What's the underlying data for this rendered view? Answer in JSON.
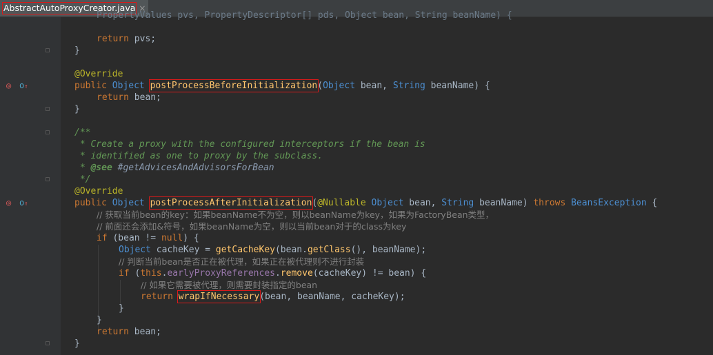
{
  "tab": {
    "filename": "AbstractAutoProxyCreator.java",
    "close": "×"
  },
  "code": {
    "l1": {
      "text": "PropertyValues pvs, PropertyDescriptor[] pds, Object bean, String beanName) {"
    },
    "l2": {
      "kw": "return",
      "rest": " pvs;"
    },
    "l3": "}",
    "l4": "@Override",
    "l5": {
      "kw": "public",
      "type": "Object",
      "method": "postProcessBeforeInitialization",
      "rest1": "(",
      "t2": "Object",
      "rest2": " bean, ",
      "t3": "String",
      "rest3": " beanName) {"
    },
    "l6": {
      "kw": "return",
      "rest": " bean;"
    },
    "l7": "}",
    "l8": "/**",
    "l9": " * Create a proxy with the configured interceptors if the bean is",
    "l10": " * identified as one to proxy by the subclass.",
    "l11": {
      "star": " * ",
      "tag": "@see",
      "ref": " #getAdvicesAndAdvisorsForBean"
    },
    "l12": " */",
    "l13": "@Override",
    "l14": {
      "kw": "public",
      "type": "Object",
      "method": "postProcessAfterInitialization",
      "p1": "(",
      "ann": "@Nullable",
      "t2": " Object",
      "r2": " bean, ",
      "t3": "String",
      "r3": " beanName) ",
      "throws": "throws",
      "t4": " BeansException",
      "r4": " {"
    },
    "l15": "// 获取当前bean的key：如果beanName不为空，则以beanName为key，如果为FactoryBean类型，",
    "l16": "// 前面还会添加&符号，如果beanName为空，则以当前bean对于的class为key",
    "l17": {
      "kw": "if",
      "r1": " (bean != ",
      "null": "null",
      "r2": ") {"
    },
    "l18": {
      "type": "Object",
      "r1": " cacheKey = ",
      "fn": "getCacheKey",
      "r2": "(bean.",
      "fn2": "getClass",
      "r3": "(), beanName);"
    },
    "l19": "// 判断当前bean是否正在被代理，如果正在被代理则不进行封装",
    "l20": {
      "kw": "if",
      "r1": " (",
      "this": "this",
      "r2": ".",
      "field": "earlyProxyReferences",
      "r3": ".",
      "fn": "remove",
      "r4": "(cacheKey) != bean) {"
    },
    "l21": "// 如果它需要被代理，则需要封装指定的bean",
    "l22": {
      "kw": "return",
      "fn": "wrapIfNecessary",
      "r1": "(bean, beanName, cacheKey);"
    },
    "l23": "}",
    "l24": "}",
    "l25": {
      "kw": "return",
      "rest": " bean;"
    },
    "l26": "}"
  },
  "colors": {
    "background": "#2b2b2b",
    "keyword": "#cc7832",
    "type": "#4c8fd2",
    "method": "#ffc66d",
    "annotation": "#bbb529",
    "doc_comment": "#629755",
    "line_comment": "#808080",
    "highlight_box": "#d91a1a"
  },
  "icons": {
    "override": "override-gutter-icon",
    "implements": "implements-gutter-icon"
  }
}
